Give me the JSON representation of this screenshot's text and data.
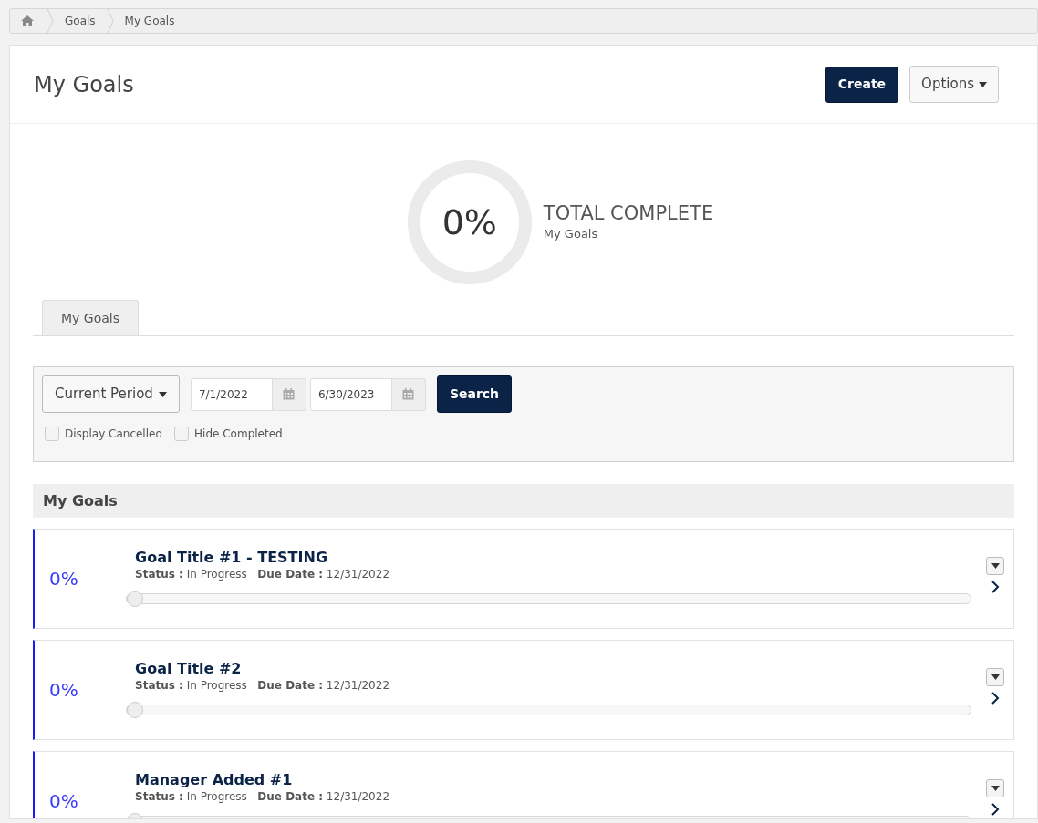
{
  "breadcrumb": [
    {
      "label": "Goals"
    },
    {
      "label": "My Goals"
    }
  ],
  "page_title": "My Goals",
  "actions": [
    {
      "label": "Create",
      "kind": "primary"
    },
    {
      "label": "Options",
      "kind": "dropdown"
    }
  ],
  "summary": {
    "percent": "0%",
    "level": 0,
    "heading": "TOTAL COMPLETE",
    "subtitle": "My Goals"
  },
  "tabs": [
    {
      "label": "My Goals",
      "selected": true
    }
  ],
  "filters": {
    "period": "Current Period",
    "start_date": "7/1/2022",
    "end_date": "6/30/2023",
    "search_button": "Search",
    "checkboxes": [
      {
        "label": "Display Cancelled",
        "checked": false
      },
      {
        "label": "Hide Completed",
        "checked": false
      }
    ]
  },
  "section_title": "My Goals",
  "goals": [
    {
      "percent": "0%",
      "title": "Goal Title #1 - TESTING",
      "status_label": "Status :",
      "status": "In Progress",
      "due_label": "Due Date :",
      "due": "12/31/2022",
      "level": 0
    },
    {
      "percent": "0%",
      "title": "Goal Title #2",
      "status_label": "Status :",
      "status": "In Progress",
      "due_label": "Due Date :",
      "due": "12/31/2022",
      "level": 0
    },
    {
      "percent": "0%",
      "title": "Manager Added #1",
      "status_label": "Status :",
      "status": "In Progress",
      "due_label": "Due Date :",
      "due": "12/31/2022",
      "level": 0
    }
  ]
}
